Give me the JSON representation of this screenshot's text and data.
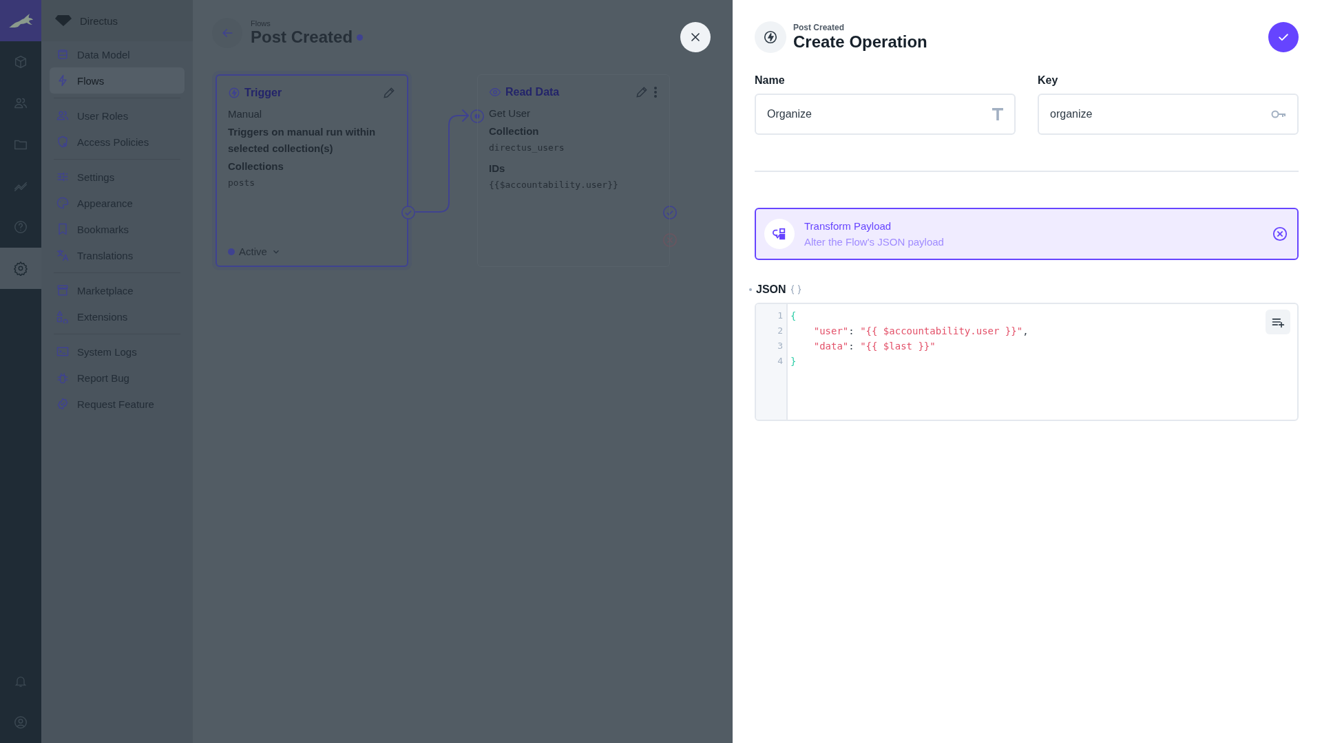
{
  "module_bar": {
    "brand": {
      "selected": true
    },
    "modules": [
      {
        "selected": false
      },
      {
        "selected": false
      },
      {
        "selected": false
      },
      {
        "selected": false
      },
      {
        "selected": false
      },
      {
        "selected": true
      }
    ]
  },
  "nav": {
    "project": "Directus",
    "groups": [
      [
        {
          "label": "Data Model",
          "selected": false
        },
        {
          "label": "Flows",
          "selected": true
        }
      ],
      [
        {
          "label": "User Roles",
          "selected": false
        },
        {
          "label": "Access Policies",
          "selected": false
        }
      ],
      [
        {
          "label": "Settings",
          "selected": false
        },
        {
          "label": "Appearance",
          "selected": false
        },
        {
          "label": "Bookmarks",
          "selected": false
        },
        {
          "label": "Translations",
          "selected": false
        }
      ],
      [
        {
          "label": "Marketplace",
          "selected": false
        },
        {
          "label": "Extensions",
          "selected": false
        }
      ],
      [
        {
          "label": "System Logs",
          "selected": false
        },
        {
          "label": "Report Bug",
          "selected": false
        },
        {
          "label": "Request Feature",
          "selected": false
        }
      ]
    ]
  },
  "flow": {
    "breadcrumb": "Flows",
    "title": "Post Created",
    "unsaved": true,
    "trigger": {
      "title": "Trigger",
      "fields": [
        {
          "kind": "text",
          "text": "Manual"
        },
        {
          "kind": "label",
          "text": "Triggers on manual run within selected collection(s)"
        },
        {
          "kind": "label",
          "text": "Collections"
        },
        {
          "kind": "value",
          "text": "posts"
        }
      ],
      "status": "Active"
    },
    "operation": {
      "title": "Read Data",
      "fields": [
        {
          "kind": "text",
          "text": "Get User"
        },
        {
          "kind": "label",
          "text": "Collection"
        },
        {
          "kind": "value",
          "text": "directus_users"
        },
        {
          "kind": "label",
          "text": "IDs"
        },
        {
          "kind": "value",
          "text": "{{$accountability.user}}"
        }
      ]
    }
  },
  "drawer": {
    "breadcrumb": "Post Created",
    "title": "Create Operation",
    "fields": [
      {
        "label": "Name",
        "value": "Organize",
        "kind": "text"
      },
      {
        "label": "Key",
        "value": "organize",
        "kind": "key"
      }
    ],
    "operation_type": {
      "name": "Transform Payload",
      "description": "Alter the Flow's JSON payload"
    },
    "json": {
      "label": "JSON",
      "required": true,
      "lines": [
        {
          "number": "1",
          "tokens": [
            {
              "kind": "brace",
              "text": "{"
            }
          ]
        },
        {
          "number": "2",
          "tokens": [
            {
              "kind": "key",
              "text": "\"user\""
            },
            {
              "kind": "punct",
              "text": ": "
            },
            {
              "kind": "string",
              "text": "\"{{ $accountability.user }}\""
            },
            {
              "kind": "punct",
              "text": ","
            }
          ]
        },
        {
          "number": "3",
          "tokens": [
            {
              "kind": "key",
              "text": "\"data\""
            },
            {
              "kind": "punct",
              "text": ": "
            },
            {
              "kind": "string",
              "text": "\"{{ $last }}\""
            }
          ]
        },
        {
          "number": "4",
          "tokens": [
            {
              "kind": "brace",
              "text": "}"
            }
          ]
        }
      ]
    }
  }
}
